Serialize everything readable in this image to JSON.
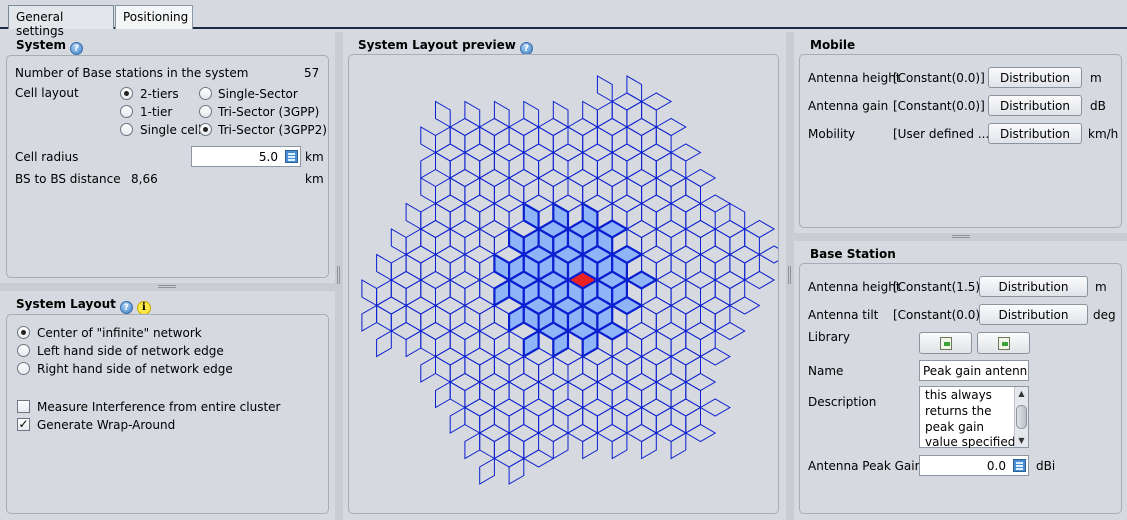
{
  "tabs": [
    {
      "label": "General settings",
      "active": false
    },
    {
      "label": "Positioning",
      "active": true
    }
  ],
  "system": {
    "title": "System",
    "num_bs_label": "Number of Base stations in the system",
    "num_bs_value": "57",
    "cell_layout_label": "Cell layout",
    "layout_options": [
      "2-tiers",
      "1-tier",
      "Single cell"
    ],
    "selected_layout": "2-tiers",
    "sector_options": [
      "Single-Sector",
      "Tri-Sector (3GPP)",
      "Tri-Sector (3GPP2)"
    ],
    "selected_sector": "Tri-Sector (3GPP2)",
    "cell_radius_label": "Cell radius",
    "cell_radius_value": "5.0",
    "cell_radius_unit": "km",
    "bs_distance_label": "BS to BS distance",
    "bs_distance_value": "8,66",
    "bs_distance_unit": "km"
  },
  "system_layout": {
    "title": "System Layout",
    "options": [
      "Center of \"infinite\" network",
      "Left hand side of network edge",
      "Right hand side of network edge"
    ],
    "selected": "Center of \"infinite\" network",
    "measure_label": "Measure Interference from entire cluster",
    "measure_checked": false,
    "wrap_label": "Generate Wrap-Around",
    "wrap_checked": true
  },
  "preview": {
    "title": "System Layout preview",
    "colors": {
      "outline": "#0a1fd0",
      "highlight_fill": "#8fb5f8",
      "highlight_border": "#0a1fd0",
      "reference": "#e82222",
      "background": "#d6d9df"
    }
  },
  "mobile": {
    "title": "Mobile",
    "rows": [
      {
        "label": "Antenna height",
        "value": "[Constant(0.0)]",
        "button": "Distribution",
        "unit": "m"
      },
      {
        "label": "Antenna gain",
        "value": "[Constant(0.0)]",
        "button": "Distribution",
        "unit": "dB"
      },
      {
        "label": "Mobility",
        "value": "[User defined ...]",
        "button": "Distribution",
        "unit": "km/h"
      }
    ]
  },
  "base_station": {
    "title": "Base Station",
    "rows": [
      {
        "label": "Antenna height",
        "value": "[Constant(1.5)]",
        "button": "Distribution",
        "unit": "m"
      },
      {
        "label": "Antenna tilt",
        "value": "[Constant(0.0)]",
        "button": "Distribution",
        "unit": "deg"
      }
    ],
    "library_label": "Library",
    "library_icons": [
      "import-icon",
      "export-icon"
    ],
    "name_label": "Name",
    "name_value": "Peak gain antenna",
    "description_label": "Description",
    "description_lines": [
      "this always",
      "returns the",
      "peak gain",
      "value specified"
    ],
    "peak_gain_label": "Antenna Peak Gain",
    "peak_gain_value": "0.0",
    "peak_gain_unit": "dBi"
  }
}
